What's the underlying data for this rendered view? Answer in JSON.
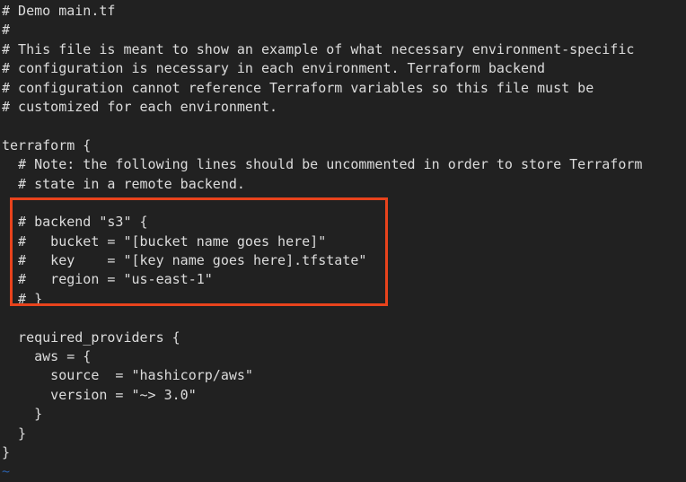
{
  "editor": {
    "background_color": "#212121",
    "text_color": "#dcdcdc",
    "tilde_color": "#2b5fa8",
    "highlight_color": "#e8431c",
    "filename_comment": "# Demo main.tf"
  },
  "code": {
    "lines": [
      "# Demo main.tf",
      "#",
      "# This file is meant to show an example of what necessary environment-specific",
      "# configuration is necessary in each environment. Terraform backend",
      "# configuration cannot reference Terraform variables so this file must be",
      "# customized for each environment.",
      "",
      "terraform {",
      "  # Note: the following lines should be uncommented in order to store Terraform",
      "  # state in a remote backend.",
      "",
      "  # backend \"s3\" {",
      "  #   bucket = \"[bucket name goes here]\"",
      "  #   key    = \"[key name goes here].tfstate\"",
      "  #   region = \"us-east-1\"",
      "  # }",
      "",
      "  required_providers {",
      "    aws = {",
      "      source  = \"hashicorp/aws\"",
      "      version = \"~> 3.0\"",
      "    }",
      "  }",
      "}",
      "~"
    ]
  },
  "highlight": {
    "label": "backend-s3-block-highlight",
    "covers_lines": [
      "# backend \"s3\" {",
      "#   bucket = \"[bucket name goes here]\"",
      "#   key    = \"[key name goes here].tfstate\"",
      "#   region = \"us-east-1\"",
      "# }"
    ]
  }
}
